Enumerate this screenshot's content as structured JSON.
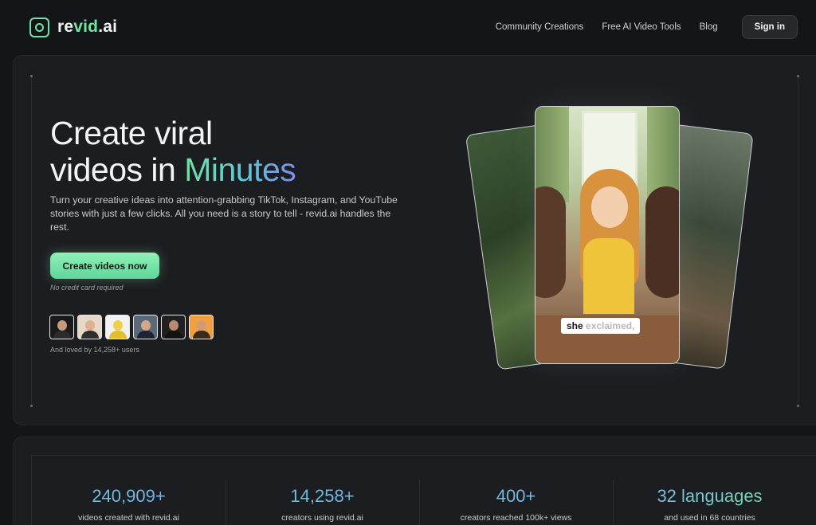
{
  "header": {
    "logo_text_main": "re",
    "logo_text_accent": "vid",
    "logo_text_suffix": ".ai",
    "nav": [
      "Community Creations",
      "Free AI Video Tools",
      "Blog"
    ],
    "signin_label": "Sign in"
  },
  "hero": {
    "headline_line1": "Create viral",
    "headline_line2_prefix": "videos in ",
    "headline_line2_accent": "Minutes",
    "description": "Turn your creative ideas into attention-grabbing TikTok, Instagram, and YouTube stories with just a few clicks. All you need is a story to tell - revid.ai handles the rest.",
    "cta_label": "Create videos now",
    "cta_note": "No credit card required",
    "loved_text": "And loved by 14,258+ users",
    "avatars": [
      {
        "bg": "#1a1a1a",
        "skin": "#c89a7d",
        "shirt": "#2b2b2b"
      },
      {
        "bg": "#e8d8c8",
        "skin": "#e0b091",
        "shirt": "#2f2f2f"
      },
      {
        "bg": "#f2f2f2",
        "skin": "#f0d04a",
        "shirt": "#e0c030"
      },
      {
        "bg": "#5a6a7a",
        "skin": "#d7a58a",
        "shirt": "#1e2530"
      },
      {
        "bg": "#202020",
        "skin": "#b88a70",
        "shirt": "#121212"
      },
      {
        "bg": "#f0a040",
        "skin": "#d49a78",
        "shirt": "#3a2a1a"
      }
    ]
  },
  "preview": {
    "caption_word1": "she",
    "caption_word2": "exclaimed,"
  },
  "stats": [
    {
      "value": "240,909+",
      "label": "videos created with revid.ai"
    },
    {
      "value": "14,258+",
      "label": "creators using revid.ai"
    },
    {
      "value": "400+",
      "label": "creators reached 100k+ views"
    },
    {
      "value": "32 languages",
      "label": "and used in 68 countries"
    }
  ]
}
